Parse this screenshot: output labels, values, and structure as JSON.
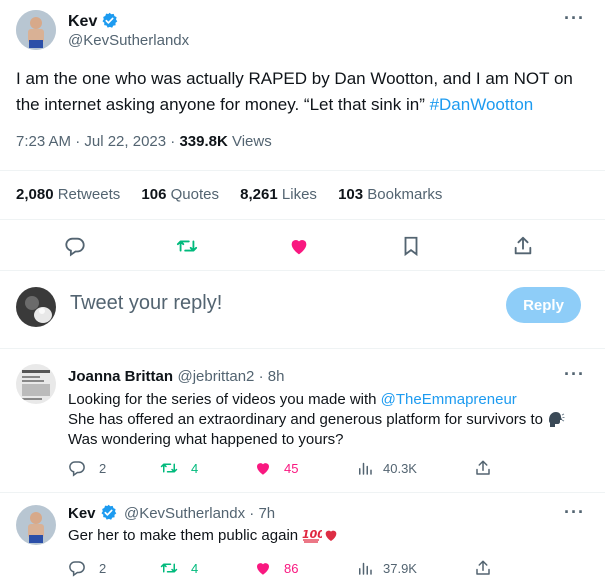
{
  "main_tweet": {
    "author_name": "Kev",
    "author_handle": "@KevSutherlandx",
    "text_main": "I am the one who was actually RAPED by Dan Wootton, and I am NOT on the internet asking anyone for money. “Let that sink in” ",
    "hashtag": "#DanWootton",
    "time": "7:23 AM · Jul 22, 2023 · ",
    "views_count": "339.8K",
    "views_label": " Views",
    "retweets_count": "2,080",
    "retweets_label": "Retweets",
    "quotes_count": "106",
    "quotes_label": "Quotes",
    "likes_count": "8,261",
    "likes_label": "Likes",
    "bookmarks_count": "103",
    "bookmarks_label": "Bookmarks"
  },
  "composer": {
    "placeholder": "Tweet your reply!",
    "button": "Reply"
  },
  "replies": [
    {
      "author_name": "Joanna Brittan",
      "author_handle": "@jebrittan2",
      "time": " · 8h",
      "line1_prefix": "Looking for the series of videos you made with ",
      "line1_mention": "@TheEmmapreneur",
      "line2": "She has offered an extraordinary and generous platform for survivors to",
      "line3": "Was wondering what happened to yours?",
      "replies_count": "2",
      "retweets_count": "4",
      "likes_count": "45",
      "views_count": "40.3K"
    },
    {
      "author_name": "Kev",
      "author_handle": "@KevSutherlandx",
      "time": " · 7h",
      "line1": "Ger her to make them public again ",
      "replies_count": "2",
      "retweets_count": "4",
      "likes_count": "86",
      "views_count": "37.9K"
    }
  ],
  "colors": {
    "accent": "#1d9bf0",
    "like": "#f91880",
    "retweet": "#00ba7c",
    "reply_button": "#8ecdf8"
  }
}
